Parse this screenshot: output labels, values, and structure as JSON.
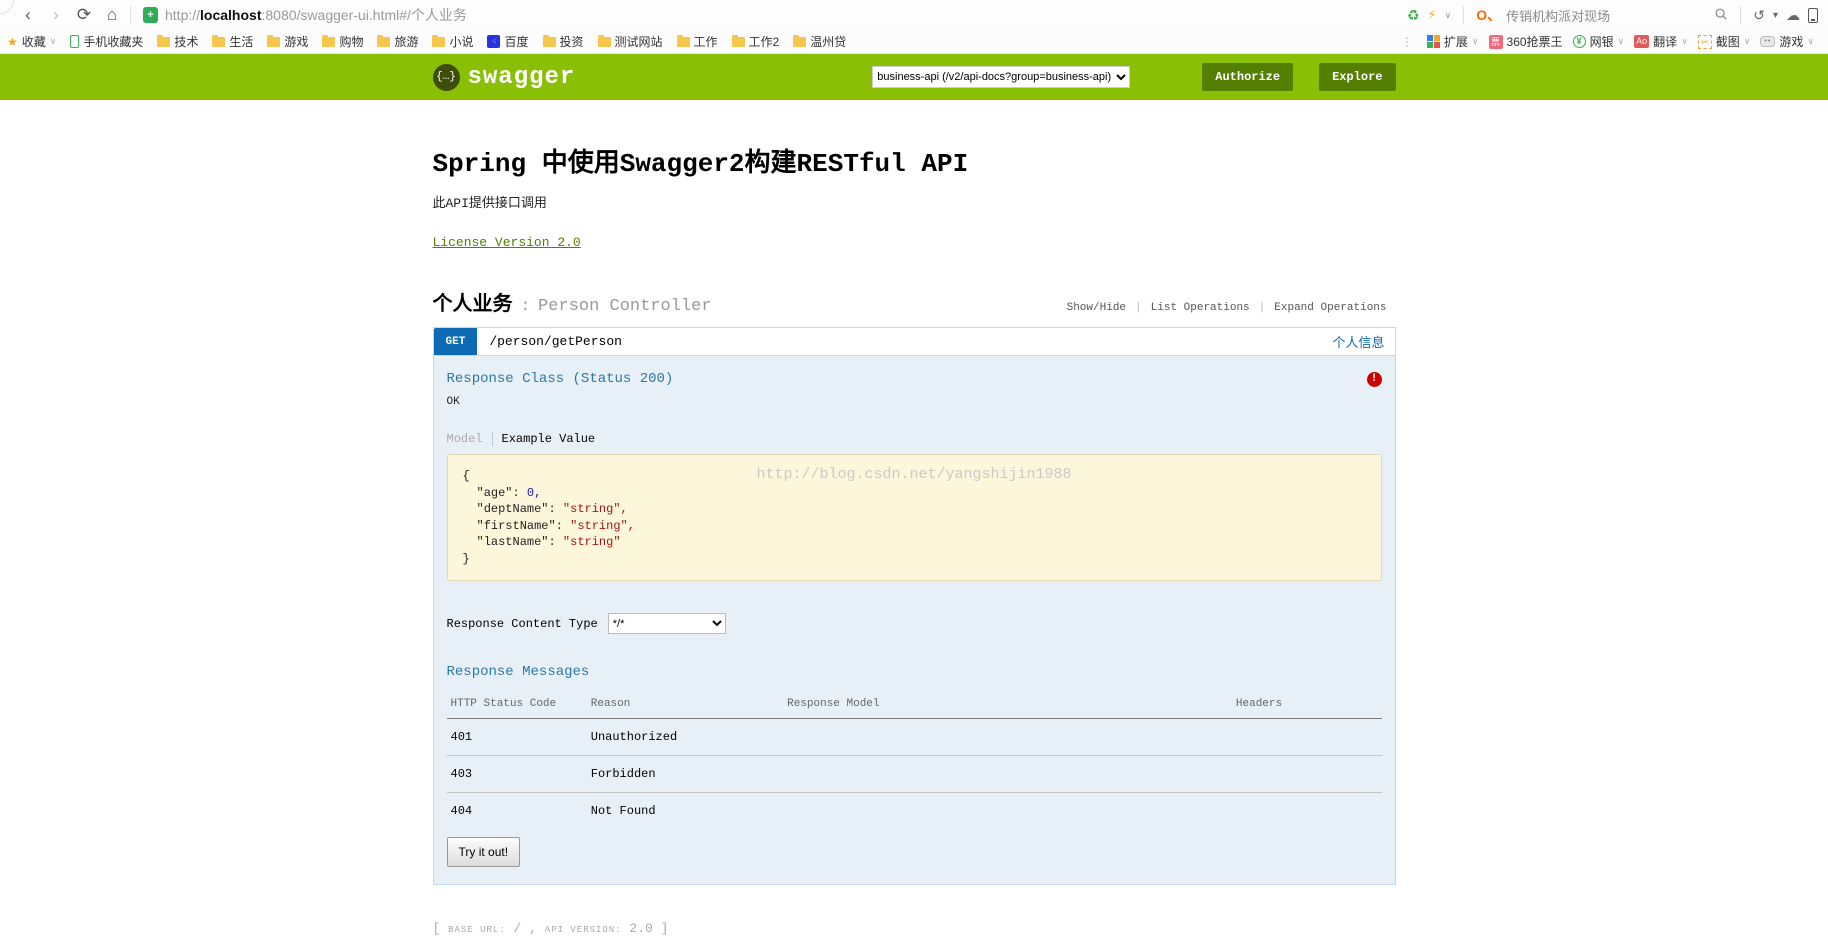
{
  "browser": {
    "nav": {
      "back": "‹",
      "forward": "›",
      "refresh": "⟳",
      "home": "⌂"
    },
    "url": {
      "shield_glyph": "+",
      "prefix": "http://",
      "host": "localhost",
      "rest": ":8080/swagger-ui.html#/个人业务"
    },
    "quick": {
      "search_logo": "O、",
      "search_text": "传销机构派对现场"
    },
    "bookmarks": [
      {
        "label": "收藏"
      },
      {
        "label": "手机收藏夹"
      },
      {
        "label": "技术"
      },
      {
        "label": "生活"
      },
      {
        "label": "游戏"
      },
      {
        "label": "购物"
      },
      {
        "label": "旅游"
      },
      {
        "label": "小说"
      },
      {
        "label": "百度"
      },
      {
        "label": "投资"
      },
      {
        "label": "测试网站"
      },
      {
        "label": "工作"
      },
      {
        "label": "工作2"
      },
      {
        "label": "温州贷"
      }
    ],
    "extensions": [
      {
        "label": "扩展"
      },
      {
        "label": "360抢票王"
      },
      {
        "label": "网银"
      },
      {
        "label": "翻译"
      },
      {
        "label": "截图"
      },
      {
        "label": "游戏"
      }
    ]
  },
  "swagger_header": {
    "logo_glyph": "{…}",
    "logo_text": "swagger",
    "api_select_value": "business-api (/v2/api-docs?group=business-api)",
    "authorize_label": "Authorize",
    "explore_label": "Explore"
  },
  "main": {
    "title": "Spring 中使用Swagger2构建RESTful API",
    "subtitle": "此API提供接口调用",
    "license_link": "License Version 2.0",
    "section": {
      "name": "个人业务",
      "separator": ":",
      "controller": "Person Controller",
      "links": [
        {
          "label": "Show/Hide"
        },
        {
          "label": "List Operations"
        },
        {
          "label": "Expand Operations"
        }
      ]
    },
    "endpoint": {
      "method": "GET",
      "path": "/person/getPerson",
      "tag": "个人信息"
    },
    "response_class": {
      "heading": "Response Class (Status 200)",
      "error_glyph": "!",
      "status_text": "OK",
      "tab_model": "Model",
      "tab_example": "Example Value"
    },
    "example": {
      "watermark": "http://blog.csdn.net/yangshijin1988",
      "open": "{",
      "close": "}",
      "fields": [
        {
          "key": "\"age\": ",
          "value": "0,"
        },
        {
          "key": "\"deptName\": ",
          "value": "\"string\","
        },
        {
          "key": "\"firstName\": ",
          "value": "\"string\","
        },
        {
          "key": "\"lastName\": ",
          "value": "\"string\""
        }
      ]
    },
    "content_type": {
      "label": "Response Content Type",
      "value": "*/*"
    },
    "messages": {
      "heading": "Response Messages",
      "columns": [
        "HTTP Status Code",
        "Reason",
        "Response Model",
        "Headers"
      ],
      "rows": [
        {
          "code": "401",
          "reason": "Unauthorized",
          "model": "",
          "headers": ""
        },
        {
          "code": "403",
          "reason": "Forbidden",
          "model": "",
          "headers": ""
        },
        {
          "code": "404",
          "reason": "Not Found",
          "model": "",
          "headers": ""
        }
      ]
    },
    "try_label": "Try it out!",
    "footer": {
      "open": "[",
      "base_label": "BASE URL:",
      "base_value": "/",
      "comma": ",",
      "ver_label": "API VERSION:",
      "ver_value": "2.0",
      "close": "]"
    }
  }
}
